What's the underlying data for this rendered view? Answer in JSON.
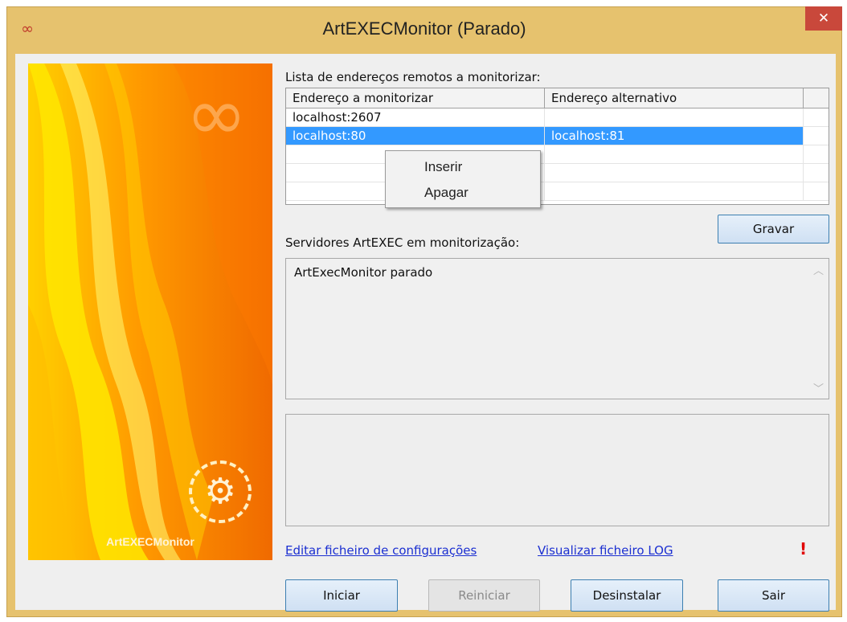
{
  "window": {
    "title": "ArtEXECMonitor (Parado)",
    "app_icon": "∞",
    "close_glyph": "✕"
  },
  "banner": {
    "label": "ArtEXECMonitor",
    "logo_glyph": "∞",
    "gear_glyph": "⚙",
    "colors": {
      "orange": "#f58200",
      "yellow": "#ffd400"
    }
  },
  "monitor_list": {
    "label": "Lista de endereços remotos a monitorizar:",
    "columns": [
      "Endereço a monitorizar",
      "Endereço alternativo"
    ],
    "rows": [
      {
        "address": "localhost:2607",
        "alternative": ""
      },
      {
        "address": "localhost:80",
        "alternative": "localhost:81"
      }
    ]
  },
  "context_menu": {
    "items": [
      "Inserir",
      "Apagar"
    ]
  },
  "save_button": {
    "label": "Gravar"
  },
  "servers": {
    "label": "Servidores ArtEXEC em monitorização:",
    "status_text": "ArtExecMonitor parado",
    "scroll_up": "︿",
    "scroll_down": "﹀"
  },
  "links": {
    "edit_config": "Editar ficheiro de configurações",
    "view_log": "Visualizar ficheiro LOG",
    "warning": "!"
  },
  "buttons": {
    "start": "Iniciar",
    "restart": "Reiniciar",
    "uninstall": "Desinstalar",
    "exit": "Sair"
  }
}
